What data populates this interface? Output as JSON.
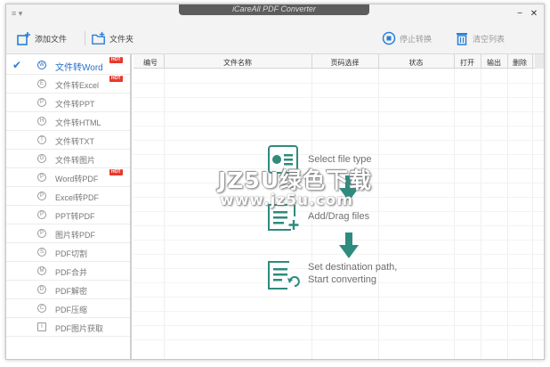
{
  "window": {
    "menu_glyph": "≡ ▾",
    "title": "iCareAll PDF Converter",
    "minimize": "−",
    "close": "✕"
  },
  "toolbar": {
    "add_file": "添加文件",
    "folder": "文件夹",
    "stop": "停止转换",
    "clear": "清空列表",
    "accent": "#2a7fd4"
  },
  "sidebar": {
    "items": [
      {
        "label": "文件转Word",
        "glyph": "W",
        "hot": "HOT",
        "active": true
      },
      {
        "label": "文件转Excel",
        "glyph": "E",
        "hot": "HOT"
      },
      {
        "label": "文件转PPT",
        "glyph": "P"
      },
      {
        "label": "文件转HTML",
        "glyph": "H"
      },
      {
        "label": "文件转TXT",
        "glyph": "T"
      },
      {
        "label": "文件转图片",
        "glyph": "G"
      },
      {
        "label": "Word转PDF",
        "glyph": "P",
        "hot": "HOT"
      },
      {
        "label": "Excel转PDF",
        "glyph": "P"
      },
      {
        "label": "PPT转PDF",
        "glyph": "P"
      },
      {
        "label": "图片转PDF",
        "glyph": "P"
      },
      {
        "label": "PDF切割",
        "glyph": "S"
      },
      {
        "label": "PDF合并",
        "glyph": "M"
      },
      {
        "label": "PDF解密",
        "glyph": "D"
      },
      {
        "label": "PDF压缩",
        "glyph": "C"
      },
      {
        "label": "PDF图片获取",
        "glyph": "I"
      }
    ]
  },
  "table": {
    "columns": [
      "编号",
      "文件名称",
      "页码选择",
      "状态",
      "打开",
      "输出",
      "删除"
    ]
  },
  "steps": {
    "step1": "Select file type",
    "step2": "Add/Drag files",
    "step3_line1": "Set destination path,",
    "step3_line2": "Start converting",
    "color": "#2e8b7e"
  },
  "watermark": {
    "brand": "JZ5U绿色下载",
    "url": "www.jz5u.com"
  }
}
